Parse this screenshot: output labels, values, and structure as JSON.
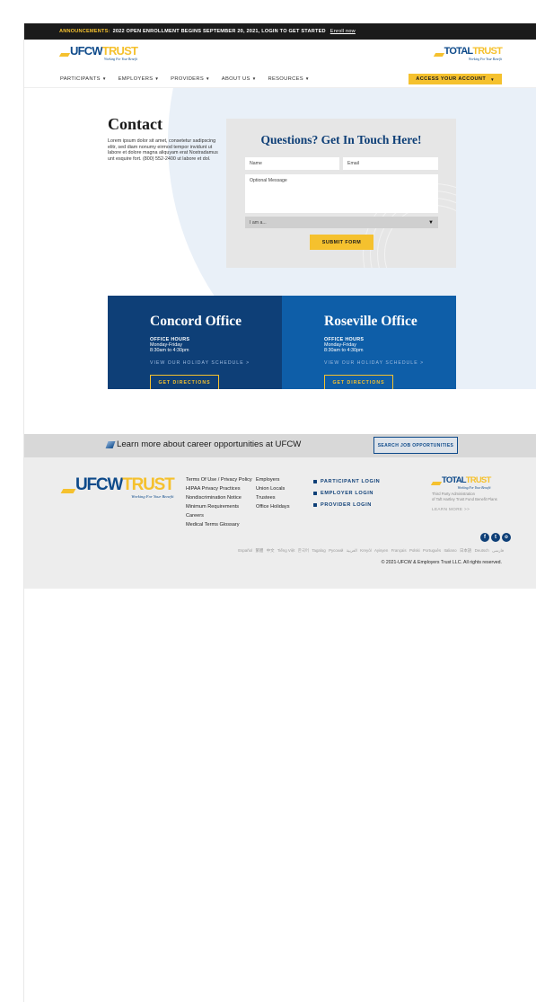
{
  "announcement": {
    "label": "ANNOUNCEMENTS:",
    "text": "2022 OPEN ENROLLMENT BEGINS SEPTEMBER 20, 2021, LOGIN TO GET STARTED",
    "link": "Enroll now"
  },
  "logos": {
    "ufcw": {
      "part1": "UFCW",
      "part2": "TRUST",
      "tagline": "Working For Your Benefit"
    },
    "total": {
      "part1": "TOTAL",
      "part2": "TRUST",
      "tagline": "Working For Your Benefit"
    }
  },
  "nav": {
    "items": [
      {
        "label": "PARTICIPANTS"
      },
      {
        "label": "EMPLOYERS"
      },
      {
        "label": "PROVIDERS"
      },
      {
        "label": "ABOUT US"
      },
      {
        "label": "RESOURCES"
      }
    ],
    "access_button": "ACCESS YOUR ACCOUNT"
  },
  "contact": {
    "title": "Contact",
    "body": "Lorem ipsum dolor sit amet, consetetur sadipscing elitr, sed diam nonumy eirmod tempor invidunt ut labore et dolore magna aliquyam erat Nostradamus unt esquire fort. (800) 552-2400 ut labore et dol."
  },
  "form": {
    "title": "Questions? Get In Touch Here!",
    "name_placeholder": "Name",
    "email_placeholder": "Email",
    "message_placeholder": "Optional Message",
    "select_value": "I am a...",
    "submit": "SUBMIT FORM"
  },
  "offices": [
    {
      "name": "Concord Office",
      "hours_label": "OFFICE HOURS",
      "days": "Monday-Friday",
      "hours": "8:30am to 4:30pm",
      "holiday_link": "VIEW OUR HOLIDAY SCHEDULE >",
      "directions": "GET DIRECTIONS"
    },
    {
      "name": "Roseville Office",
      "hours_label": "OFFICE HOURS",
      "days": "Monday-Friday",
      "hours": "8:30am to 4:30pm",
      "holiday_link": "VIEW OUR HOLIDAY SCHEDULE >",
      "directions": "GET DIRECTIONS"
    }
  ],
  "careers": {
    "text": "Learn more about career opportunities at UFCW",
    "button": "SEARCH JOB OPPORTUNITIES"
  },
  "footer": {
    "col1": [
      "Terms Of Use / Privacy Policy",
      "HIPAA Privacy Practices",
      "Nondiscrimination Notice",
      "Minimum Requirements",
      "Careers",
      "Medical Terms Glossary"
    ],
    "col2": [
      "Employers",
      "Union Locals",
      "Trustees",
      "Office Holidays"
    ],
    "logins": [
      "PARTICIPANT LOGIN",
      "EMPLOYER LOGIN",
      "PROVIDER LOGIN"
    ],
    "tpa_line1": "Third Party Administration",
    "tpa_line2": "of Taft Hartley Trust Fund Benefit Plans",
    "learn_more": "LEARN MORE >>",
    "social": [
      "f",
      "t",
      "o"
    ],
    "languages": [
      "Español",
      "繁體",
      "中文",
      "Tiếng Việt",
      "한국어",
      "Tagalog",
      "Русский",
      "العربية",
      "Kreyòl",
      "Ayisyen",
      "Français",
      "Polski",
      "Português",
      "Italiano",
      "日本語",
      "Deutsch",
      "فارسی"
    ],
    "copyright": "© 2021-UFCW & Employers Trust LLC. All rights reserved."
  },
  "colors": {
    "navy": "#0e3f77",
    "blue": "#0e5ea8",
    "gold": "#f5c12e",
    "dark": "#1b1b1b"
  }
}
